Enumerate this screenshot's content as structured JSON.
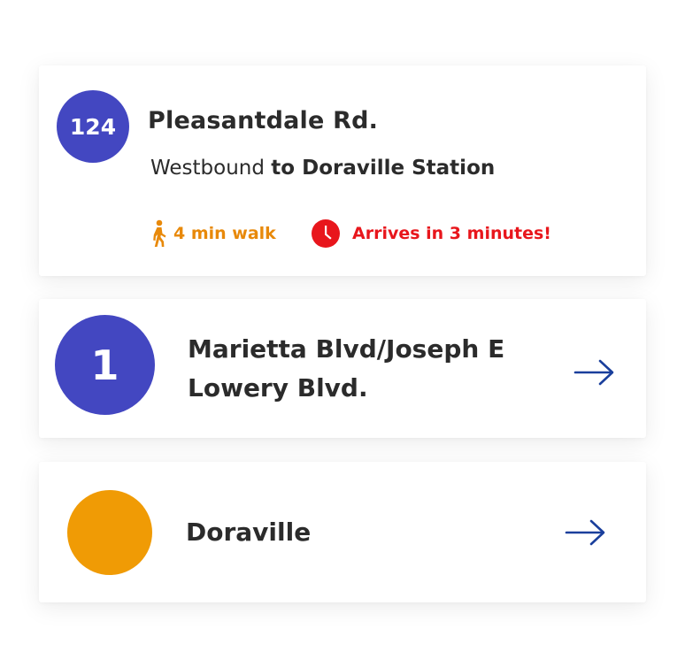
{
  "colors": {
    "route_badge_blue": "#4347c1",
    "route_badge_orange": "#f09b05",
    "walk_orange": "#e8890a",
    "alert_red": "#e8161c",
    "arrow_blue": "#1a3f9c",
    "text_dark": "#2b2b2b"
  },
  "primary_route": {
    "number": "124",
    "stop_name": "Pleasantdale Rd.",
    "direction_prefix": "Westbound",
    "direction_to": "to Doraville Station",
    "walk_icon": "walking-person-icon",
    "walk_text": "4 min walk",
    "clock_icon": "clock-icon",
    "arrival_text": "Arrives in 3 minutes!"
  },
  "routes": [
    {
      "number": "1",
      "label": "Marietta Blvd/Joseph E Lowery Blvd.",
      "arrow_icon": "arrow-right-icon"
    },
    {
      "number": "",
      "label": "Doraville",
      "arrow_icon": "arrow-right-icon"
    }
  ]
}
